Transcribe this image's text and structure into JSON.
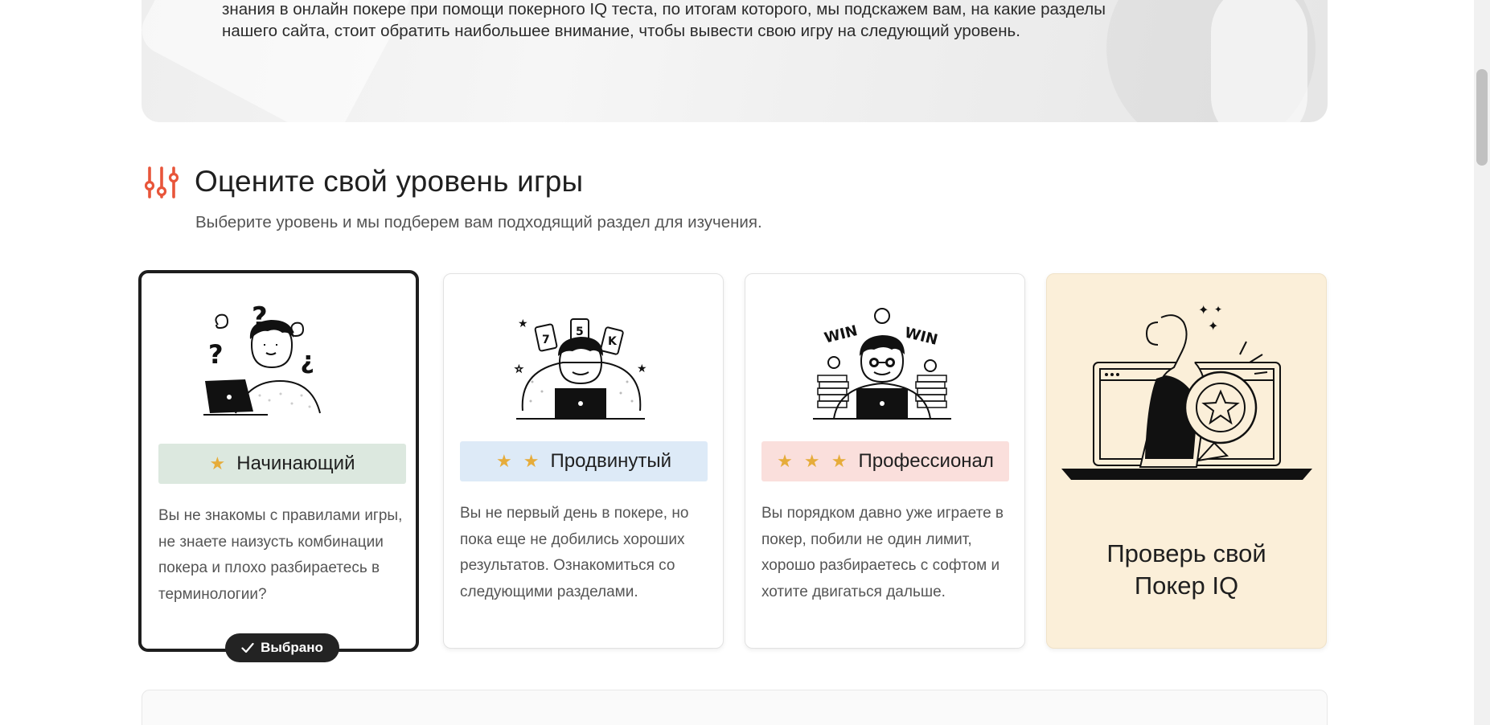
{
  "hero": {
    "text_line1": "знания в онлайн покере при помощи покерного IQ теста, по итогам которого, мы подскажем вам, на какие разделы",
    "text_line2": "нашего сайта, стоит обратить наибольшее внимание, чтобы вывести свою игру на следующий уровень."
  },
  "section": {
    "title": "Оцените свой уровень игры",
    "subtitle": "Выберите уровень и мы подберем вам подходящий раздел для изучения."
  },
  "levels": [
    {
      "stars": "★",
      "label": "Начинающий",
      "description": "Вы не знакомы с правилами игры, не знаете наизусть комбинации покера и плохо разбираетесь в терминологии?",
      "selected_label": "Выбрано"
    },
    {
      "stars": "★ ★",
      "label": "Продвинутый",
      "description": "Вы не первый день в покере, но пока еще не добились хороших результатов. Ознакомиться со следующими разделами."
    },
    {
      "stars": "★ ★ ★",
      "label": "Профессионал",
      "description": "Вы порядком давно уже играете в покер, побили не один лимит, хорошо разбираетесь с софтом и хотите двигаться дальше."
    }
  ],
  "iq_card": {
    "title_line1": "Проверь свой",
    "title_line2": "Покер IQ"
  },
  "illustration_text": {
    "card1": "7",
    "card2": "5",
    "card3": "K",
    "win": "WIN"
  },
  "colors": {
    "accent": "#e8553a",
    "star": "#e6ac3a",
    "badge_beginner": "#dce8df",
    "badge_advanced": "#ddeaf7",
    "badge_pro": "#fadfdc",
    "iq_card_bg": "#fbefd9",
    "selected_border": "#1e1e1e"
  },
  "icons": {
    "heading": "sliders-icon",
    "selected": "check-icon"
  }
}
